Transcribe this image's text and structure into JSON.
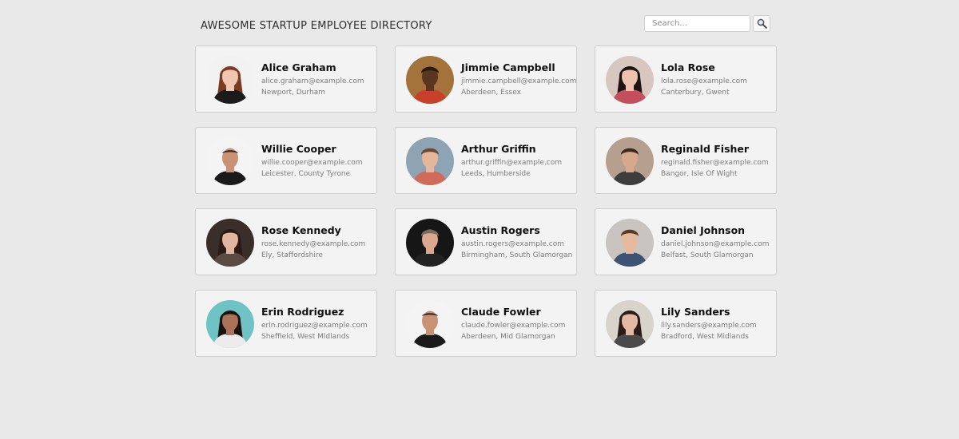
{
  "header": {
    "title": "AWESOME STARTUP EMPLOYEE DIRECTORY"
  },
  "search": {
    "placeholder": "Search...",
    "value": "",
    "button_icon": "magnifier-icon"
  },
  "employees": [
    {
      "name": "Alice Graham",
      "email": "alice.graham@example.com",
      "location": "Newport, Durham",
      "bg": "#f2f2f2",
      "skin": "#efc6b0",
      "hair": "#7a3b22",
      "shirt": "#1b1b1b",
      "hair_style": "long"
    },
    {
      "name": "Jimmie Campbell",
      "email": "jimmie.campbell@example.com",
      "location": "Aberdeen, Essex",
      "bg": "#a4733c",
      "skin": "#5a3520",
      "hair": "#2a1a12",
      "shirt": "#c9402a",
      "hair_style": "short"
    },
    {
      "name": "Lola Rose",
      "email": "lola.rose@example.com",
      "location": "Canterbury, Gwent",
      "bg": "#d8c7c0",
      "skin": "#edc3b0",
      "hair": "#1e1413",
      "shirt": "#c44f5c",
      "hair_style": "long"
    },
    {
      "name": "Willie Cooper",
      "email": "willie.cooper@example.com",
      "location": "Leicester, County Tyrone",
      "bg": "#f4f4f4",
      "skin": "#c99274",
      "hair": "#3a2a22",
      "shirt": "#1a1a1a",
      "hair_style": "bald"
    },
    {
      "name": "Arthur Griffin",
      "email": "arthur.griffin@example.com",
      "location": "Leeds, Humberside",
      "bg": "#8ea3b4",
      "skin": "#e5b79a",
      "hair": "#6b4a33",
      "shirt": "#d06a5a",
      "hair_style": "short"
    },
    {
      "name": "Reginald Fisher",
      "email": "reginald.fisher@example.com",
      "location": "Bangor, Isle Of Wight",
      "bg": "#b69f8f",
      "skin": "#d8a88c",
      "hair": "#3b2a20",
      "shirt": "#3d3d3d",
      "hair_style": "short"
    },
    {
      "name": "Rose Kennedy",
      "email": "rose.kennedy@example.com",
      "location": "Ely, Staffordshire",
      "bg": "#3a2e2a",
      "skin": "#e0b6a0",
      "hair": "#2b1a14",
      "shirt": "#5a4a44",
      "hair_style": "long"
    },
    {
      "name": "Austin Rogers",
      "email": "austin.rogers@example.com",
      "location": "Birmingham, South Glamorgan",
      "bg": "#161616",
      "skin": "#d9a88e",
      "hair": "#7a6a60",
      "shirt": "#222222",
      "hair_style": "short"
    },
    {
      "name": "Daniel Johnson",
      "email": "daniel.johnson@example.com",
      "location": "Belfast, South Glamorgan",
      "bg": "#c9c4c0",
      "skin": "#e6b89c",
      "hair": "#5a3a26",
      "shirt": "#3c5374",
      "hair_style": "short"
    },
    {
      "name": "Erin Rodriguez",
      "email": "erin.rodriguez@example.com",
      "location": "Sheffield, West Midlands",
      "bg": "#6fc3c4",
      "skin": "#a9745a",
      "hair": "#1a120e",
      "shirt": "#ececec",
      "hair_style": "long"
    },
    {
      "name": "Claude Fowler",
      "email": "claude.fowler@example.com",
      "location": "Aberdeen, Mid Glamorgan",
      "bg": "#f4f4f4",
      "skin": "#c99274",
      "hair": "#3a2a22",
      "shirt": "#1a1a1a",
      "hair_style": "bald"
    },
    {
      "name": "Lily Sanders",
      "email": "lily.sanders@example.com",
      "location": "Bradford, West Midlands",
      "bg": "#d8d4cc",
      "skin": "#e2b9a2",
      "hair": "#2a1c16",
      "shirt": "#4a4a4a",
      "hair_style": "long"
    }
  ]
}
